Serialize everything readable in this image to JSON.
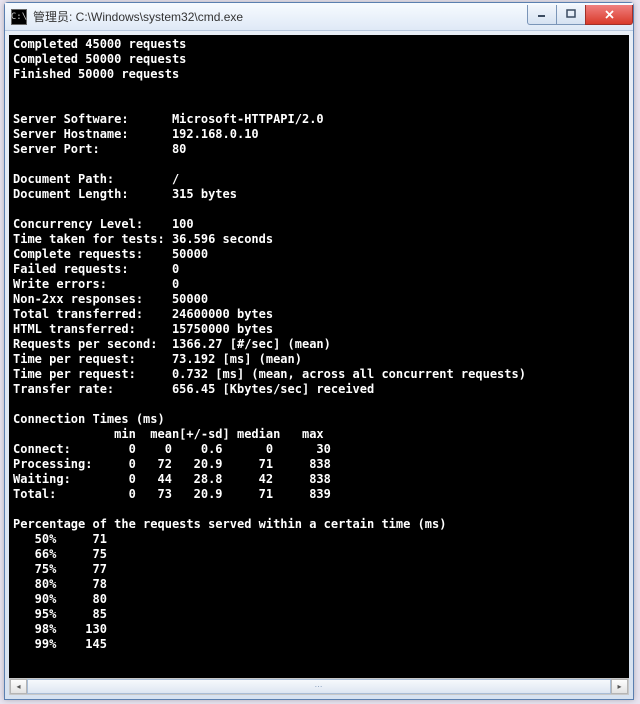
{
  "window": {
    "title": "管理员: C:\\Windows\\system32\\cmd.exe",
    "icon_text": "C:\\"
  },
  "progress_lines": [
    "Completed 45000 requests",
    "Completed 50000 requests",
    "Finished 50000 requests"
  ],
  "server_info": [
    {
      "label": "Server Software:",
      "value": "Microsoft-HTTPAPI/2.0"
    },
    {
      "label": "Server Hostname:",
      "value": "192.168.0.10"
    },
    {
      "label": "Server Port:",
      "value": "80"
    }
  ],
  "document_info": [
    {
      "label": "Document Path:",
      "value": "/"
    },
    {
      "label": "Document Length:",
      "value": "315 bytes"
    }
  ],
  "stats": [
    {
      "label": "Concurrency Level:",
      "value": "100"
    },
    {
      "label": "Time taken for tests:",
      "value": "36.596 seconds"
    },
    {
      "label": "Complete requests:",
      "value": "50000"
    },
    {
      "label": "Failed requests:",
      "value": "0"
    },
    {
      "label": "Write errors:",
      "value": "0"
    },
    {
      "label": "Non-2xx responses:",
      "value": "50000"
    },
    {
      "label": "Total transferred:",
      "value": "24600000 bytes"
    },
    {
      "label": "HTML transferred:",
      "value": "15750000 bytes"
    },
    {
      "label": "Requests per second:",
      "value": "1366.27 [#/sec] (mean)"
    },
    {
      "label": "Time per request:",
      "value": "73.192 [ms] (mean)"
    },
    {
      "label": "Time per request:",
      "value": "0.732 [ms] (mean, across all concurrent requests)"
    },
    {
      "label": "Transfer rate:",
      "value": "656.45 [Kbytes/sec] received"
    }
  ],
  "conn_heading": "Connection Times (ms)",
  "conn_header": {
    "c1": "min",
    "c2": "mean",
    "c3": "[+/-sd]",
    "c4": "median",
    "c5": "max"
  },
  "conn_rows": [
    {
      "name": "Connect:",
      "min": "0",
      "mean": "0",
      "sd": "0.6",
      "median": "0",
      "max": "30"
    },
    {
      "name": "Processing:",
      "min": "0",
      "mean": "72",
      "sd": "20.9",
      "median": "71",
      "max": "838"
    },
    {
      "name": "Waiting:",
      "min": "0",
      "mean": "44",
      "sd": "28.8",
      "median": "42",
      "max": "838"
    },
    {
      "name": "Total:",
      "min": "0",
      "mean": "73",
      "sd": "20.9",
      "median": "71",
      "max": "839"
    }
  ],
  "pct_heading": "Percentage of the requests served within a certain time (ms)",
  "pct_rows": [
    {
      "p": "50%",
      "v": "71"
    },
    {
      "p": "66%",
      "v": "75"
    },
    {
      "p": "75%",
      "v": "77"
    },
    {
      "p": "80%",
      "v": "78"
    },
    {
      "p": "90%",
      "v": "80"
    },
    {
      "p": "95%",
      "v": "85"
    },
    {
      "p": "98%",
      "v": "130"
    },
    {
      "p": "99%",
      "v": "145"
    }
  ]
}
